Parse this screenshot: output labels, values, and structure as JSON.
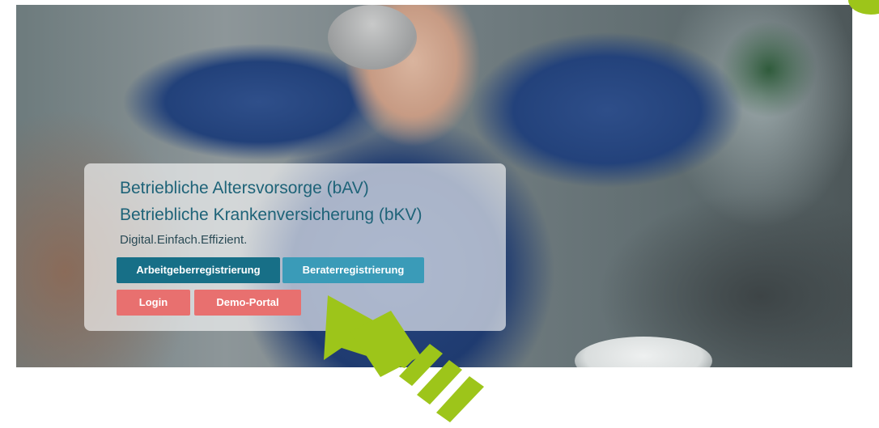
{
  "hero": {
    "title_line1": "Betriebliche Altersvorsorge (bAV)",
    "title_line2": "Betriebliche Krankenversicherung (bKV)",
    "tagline": "Digital.Einfach.Effizient."
  },
  "buttons": {
    "arbeitgeber": "Arbeitgeberregistrierung",
    "berater": "Beraterregistrierung",
    "login": "Login",
    "demo": "Demo-Portal"
  },
  "colors": {
    "primary_teal": "#176f87",
    "light_teal": "#3a9bb8",
    "coral": "#e8706f",
    "arrow_green": "#9dc51a"
  },
  "icons": {
    "highlight_arrow": "green-arrow-icon"
  }
}
